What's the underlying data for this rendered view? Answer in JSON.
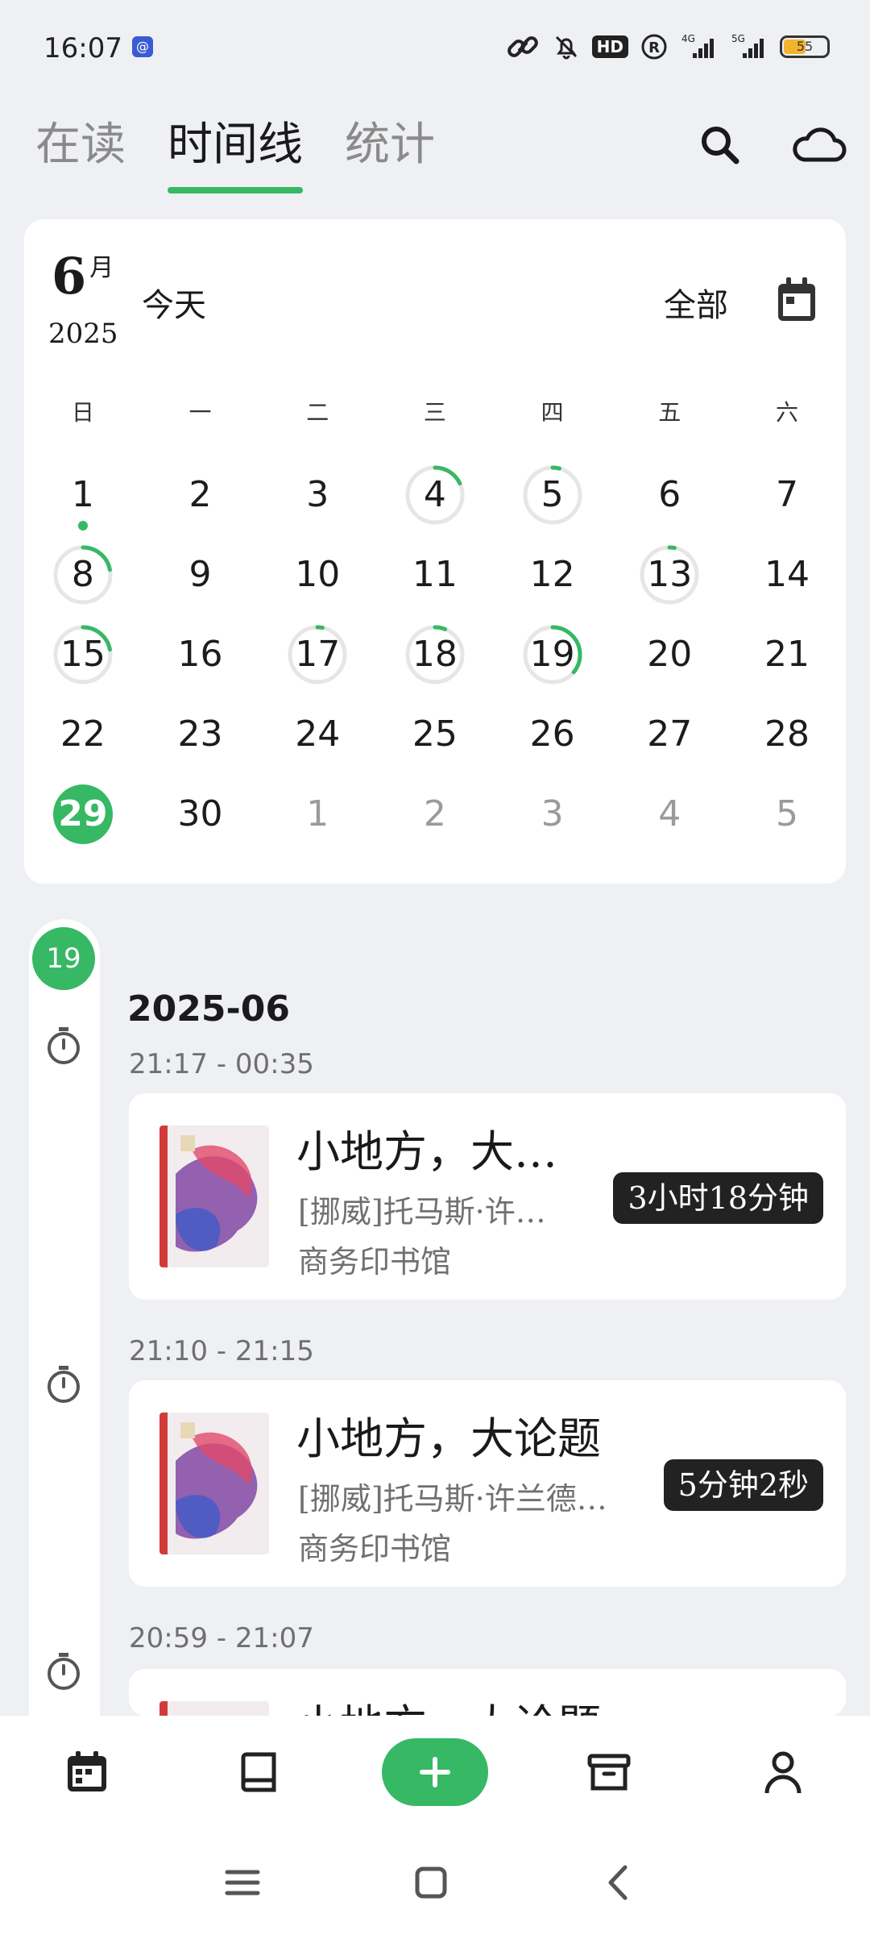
{
  "status_bar": {
    "time": "16:07",
    "hd_label": "HD",
    "signal_4g": "4G",
    "signal_5g": "5G",
    "battery": "55"
  },
  "tabs": [
    {
      "label": "在读",
      "active": false
    },
    {
      "label": "时间线",
      "active": true
    },
    {
      "label": "统计",
      "active": false
    }
  ],
  "calendar": {
    "month": "6",
    "month_unit": "月",
    "year": "2025",
    "today_label": "今天",
    "filter_label": "全部",
    "weekdays": [
      "日",
      "一",
      "二",
      "三",
      "四",
      "五",
      "六"
    ],
    "weeks": [
      [
        {
          "d": "1",
          "dot": true
        },
        {
          "d": "2"
        },
        {
          "d": "3"
        },
        {
          "d": "4",
          "p": 0.18
        },
        {
          "d": "5",
          "p": 0.04
        },
        {
          "d": "6"
        },
        {
          "d": "7"
        }
      ],
      [
        {
          "d": "8",
          "p": 0.22
        },
        {
          "d": "9"
        },
        {
          "d": "10"
        },
        {
          "d": "11"
        },
        {
          "d": "12"
        },
        {
          "d": "13",
          "p": 0.03
        },
        {
          "d": "14"
        }
      ],
      [
        {
          "d": "15",
          "p": 0.22
        },
        {
          "d": "16"
        },
        {
          "d": "17",
          "p": 0.03
        },
        {
          "d": "18",
          "p": 0.06
        },
        {
          "d": "19",
          "p": 0.36
        },
        {
          "d": "20"
        },
        {
          "d": "21"
        }
      ],
      [
        {
          "d": "22"
        },
        {
          "d": "23"
        },
        {
          "d": "24"
        },
        {
          "d": "25"
        },
        {
          "d": "26"
        },
        {
          "d": "27"
        },
        {
          "d": "28"
        }
      ],
      [
        {
          "d": "29",
          "today": true
        },
        {
          "d": "30"
        },
        {
          "d": "1",
          "other": true
        },
        {
          "d": "2",
          "other": true
        },
        {
          "d": "3",
          "other": true
        },
        {
          "d": "4",
          "other": true
        },
        {
          "d": "5",
          "other": true
        }
      ]
    ]
  },
  "timeline": {
    "day_badge": "19",
    "section_date": "2025-06",
    "entries": [
      {
        "time_range": "21:17 - 00:35",
        "title": "小地方，大…",
        "author": "[挪威]托马斯·许…",
        "publisher": "商务印书馆",
        "duration": "3小时18分钟"
      },
      {
        "time_range": "21:10 - 21:15",
        "title": "小地方，大论题",
        "author": "[挪威]托马斯·许兰德…",
        "publisher": "商务印书馆",
        "duration": "5分钟2秒"
      },
      {
        "time_range": "20:59 - 21:07",
        "title": "小地方，大论题",
        "author": "",
        "publisher": "",
        "duration": ""
      }
    ]
  },
  "icons": {
    "search": "search-icon",
    "cloud": "cloud-icon",
    "calendar": "calendar-icon",
    "timer": "timer-icon",
    "nav": [
      "calendar-icon",
      "book-icon",
      "plus-icon",
      "archive-icon",
      "person-icon"
    ]
  },
  "colors": {
    "accent": "#37b865",
    "background": "#eef0f3",
    "card": "#ffffff",
    "badge_dark": "#222222"
  }
}
